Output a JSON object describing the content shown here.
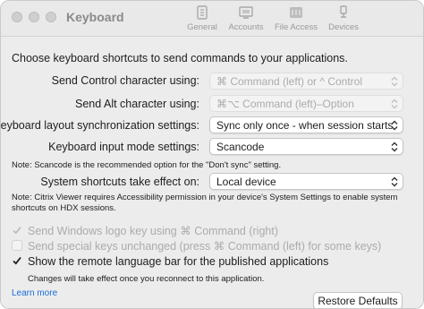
{
  "window": {
    "title": "Keyboard",
    "tabs": [
      {
        "label": "General",
        "icon": "general-icon"
      },
      {
        "label": "Accounts",
        "icon": "accounts-icon"
      },
      {
        "label": "File Access",
        "icon": "file-access-icon"
      },
      {
        "label": "Devices",
        "icon": "devices-icon"
      }
    ]
  },
  "intro": "Choose keyboard shortcuts to send commands to your applications.",
  "settings": {
    "control": {
      "label": "Send Control character using:",
      "value": "⌘ Command (left) or ^ Control",
      "enabled": false
    },
    "alt": {
      "label": "Send Alt character using:",
      "value": "⌘⌥ Command (left)–Option",
      "enabled": false
    },
    "layout_sync": {
      "label": "Keyboard layout synchronization settings:",
      "value": "Sync only once - when session starts",
      "enabled": true
    },
    "input_mode": {
      "label": "Keyboard input mode settings:",
      "value": "Scancode",
      "enabled": true
    },
    "shortcuts_effect": {
      "label": "System shortcuts take effect on:",
      "value": "Local device",
      "enabled": true
    }
  },
  "notes": {
    "scancode": "Note: Scancode is the recommended option for the \"Don't sync\" setting.",
    "accessibility": "Note: Citrix Viewer requires Accessibility permission in your device's System Settings to enable system shortcuts on HDX sessions."
  },
  "checkboxes": [
    {
      "label": "Send Windows logo key using ⌘ Command (right)",
      "checked": true,
      "enabled": false
    },
    {
      "label": "Send special keys unchanged (press ⌘ Command (left) for some keys)",
      "checked": false,
      "enabled": false
    },
    {
      "label": "Show the remote language bar for the published applications",
      "checked": true,
      "enabled": true
    }
  ],
  "changes_note": "Changes will take effect once you reconnect to this application.",
  "learn_more": "Learn more",
  "restore_defaults": "Restore Defaults"
}
